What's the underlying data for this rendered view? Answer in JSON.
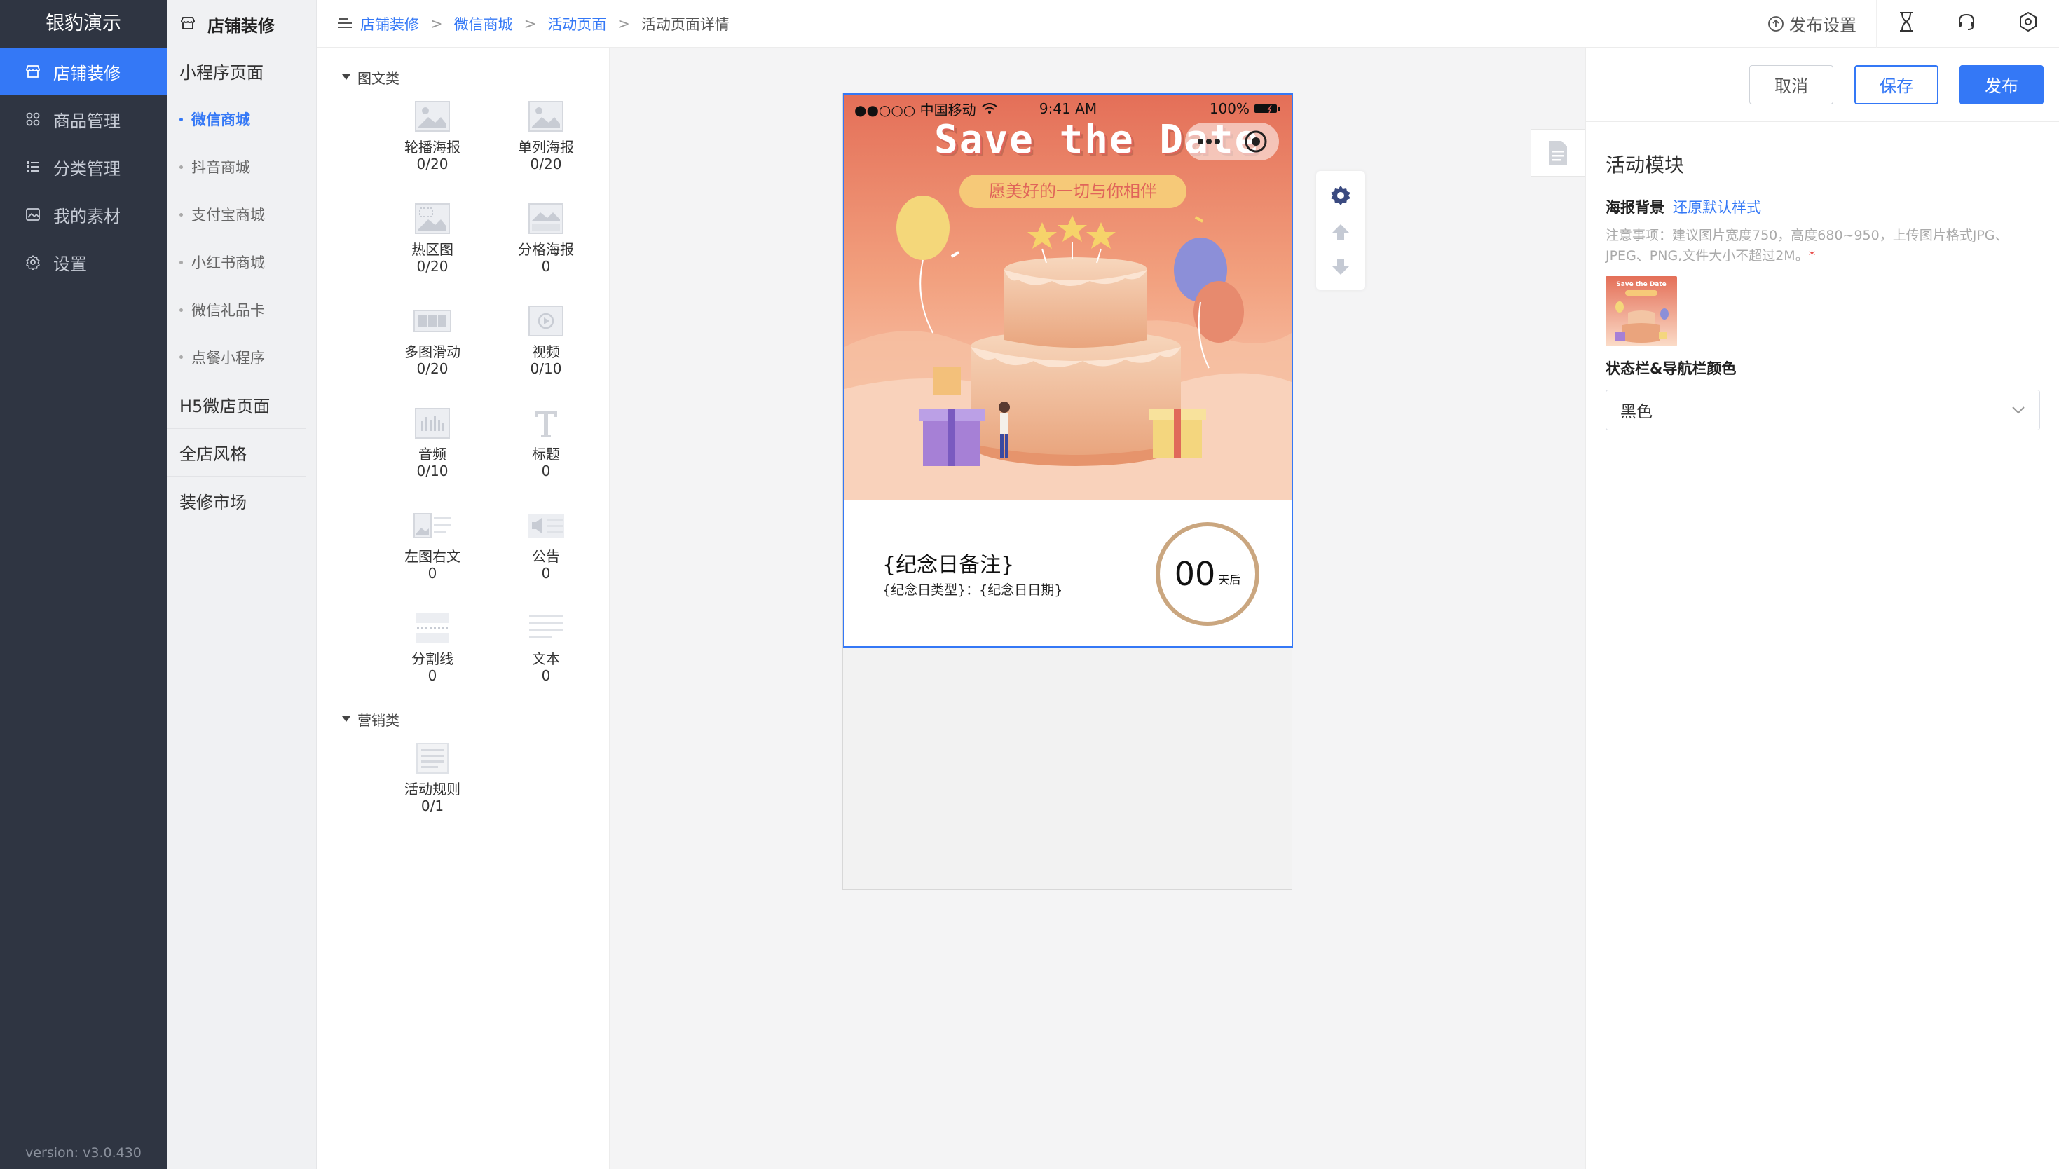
{
  "nav": {
    "brand": "银豹演示",
    "items": [
      {
        "label": "店铺装修",
        "icon": "store-icon",
        "active": true
      },
      {
        "label": "商品管理",
        "icon": "grid-icon",
        "active": false
      },
      {
        "label": "分类管理",
        "icon": "list-icon",
        "active": false
      },
      {
        "label": "我的素材",
        "icon": "image-box-icon",
        "active": false
      },
      {
        "label": "设置",
        "icon": "gear-icon",
        "active": false
      }
    ],
    "version": "version: v3.0.430"
  },
  "subnav": {
    "title": "店铺装修",
    "groups": {
      "miniapp": "小程序页面",
      "h5": "H5微店页面",
      "style": "全店风格",
      "market": "装修市场"
    },
    "subs": [
      "微信商城",
      "抖音商城",
      "支付宝商城",
      "小红书商城",
      "微信礼品卡",
      "点餐小程序"
    ]
  },
  "breadcrumb": {
    "items": [
      "店铺装修",
      "微信商城",
      "活动页面"
    ],
    "sep": ">",
    "current": "活动页面详情"
  },
  "topbar": {
    "publish_settings": "发布设置"
  },
  "components": {
    "cat1": "图文类",
    "cat2": "营销类",
    "list1": [
      {
        "label": "轮播海报",
        "count": "0/20",
        "icon": "image-icon"
      },
      {
        "label": "单列海报",
        "count": "0/20",
        "icon": "image-icon"
      },
      {
        "label": "热区图",
        "count": "0/20",
        "icon": "hotspot-image-icon"
      },
      {
        "label": "分格海报",
        "count": "0",
        "icon": "split-image-icon"
      },
      {
        "label": "多图滑动",
        "count": "0/20",
        "icon": "multi-image-icon"
      },
      {
        "label": "视频",
        "count": "0/10",
        "icon": "video-icon"
      },
      {
        "label": "音频",
        "count": "0/10",
        "icon": "audio-icon"
      },
      {
        "label": "标题",
        "count": "0",
        "icon": "title-text-icon"
      },
      {
        "label": "左图右文",
        "count": "0",
        "icon": "image-text-icon"
      },
      {
        "label": "公告",
        "count": "0",
        "icon": "speaker-icon"
      },
      {
        "label": "分割线",
        "count": "0",
        "icon": "divider-icon"
      },
      {
        "label": "文本",
        "count": "0",
        "icon": "text-lines-icon"
      }
    ],
    "list2": [
      {
        "label": "活动规则",
        "count": "0/1",
        "icon": "rules-doc-icon"
      }
    ]
  },
  "phone": {
    "carrier": "●●○○○ 中国移动",
    "time": "9:41 AM",
    "battery": "100%",
    "title_art": "Save the Date",
    "ribbon": "愿美好的一切与你相伴",
    "note": "{纪念日备注}",
    "subline": "{纪念日类型}：{纪念日日期}",
    "days": "00",
    "days_unit": "天后"
  },
  "props": {
    "cancel": "取消",
    "save": "保存",
    "publish": "发布",
    "section_title": "活动模块",
    "bg_label": "海报背景",
    "restore": "还原默认样式",
    "note": "注意事项：建议图片宽度750，高度680~950，上传图片格式JPG、JPEG、PNG,文件大小不超过2M。",
    "required_mark": "*",
    "thumb_title": "Save the Date",
    "status_label": "状态栏&导航栏颜色",
    "status_value": "黑色"
  },
  "colors": {
    "primary": "#3478f6",
    "nav_bg": "#2f3542",
    "poster_top": "#e8765c",
    "poster_bottom": "#f8d6c2",
    "ring": "#caa67f"
  }
}
